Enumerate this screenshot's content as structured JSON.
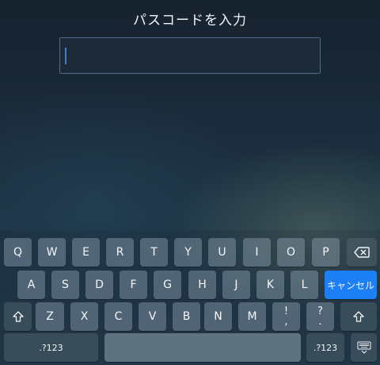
{
  "header": {
    "title": "パスコードを入力"
  },
  "passcode": {
    "value": ""
  },
  "keyboard": {
    "row1": [
      "Q",
      "W",
      "E",
      "R",
      "T",
      "Y",
      "U",
      "I",
      "O",
      "P"
    ],
    "row2": [
      "A",
      "S",
      "D",
      "F",
      "G",
      "H",
      "J",
      "K",
      "L"
    ],
    "row3": [
      "Z",
      "X",
      "C",
      "V",
      "B",
      "N",
      "M"
    ],
    "cancel_label": "キャンセル",
    "exclaim_top": "!",
    "exclaim_bottom": ",",
    "question_top": "?",
    "question_bottom": ".",
    "numbers_left": ".?123",
    "numbers_right": ".?123",
    "space_label": "",
    "icons": {
      "backspace": "backspace-icon",
      "shift": "shift-icon",
      "hide": "hide-keyboard-icon"
    }
  }
}
